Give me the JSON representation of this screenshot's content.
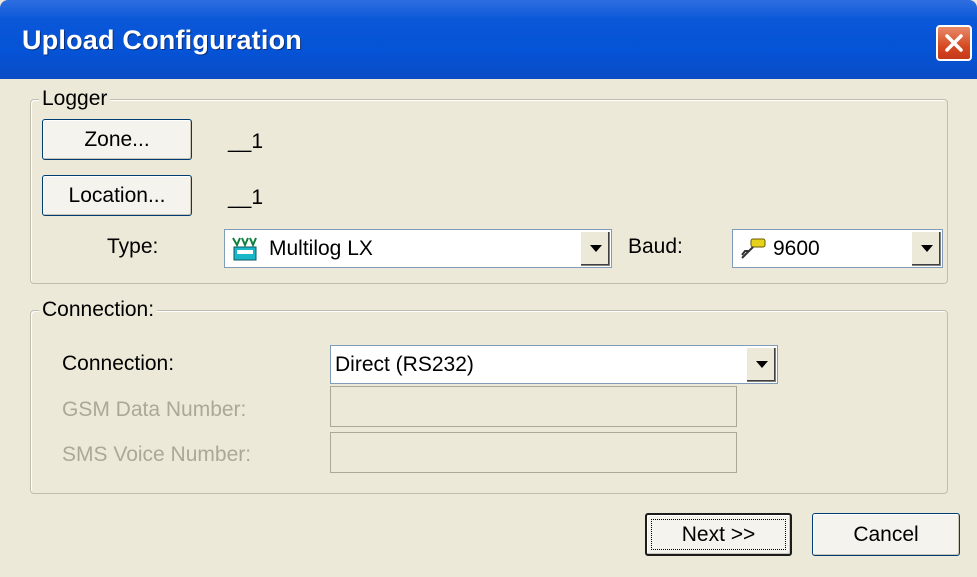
{
  "window": {
    "title": "Upload Configuration"
  },
  "logger": {
    "legend": "Logger",
    "zone_button": "Zone...",
    "zone_value": "__1",
    "location_button": "Location...",
    "location_value": "__1",
    "type_label": "Type:",
    "type_value": "Multilog LX",
    "type_icon": "multilog-device-icon",
    "baud_label": "Baud:",
    "baud_value": "9600",
    "baud_icon": "serial-cable-icon"
  },
  "connection": {
    "legend": "Connection:",
    "connection_label": "Connection:",
    "connection_value": "Direct (RS232)",
    "gsm_label": "GSM Data Number:",
    "gsm_value": "",
    "sms_label": "SMS Voice Number:",
    "sms_value": ""
  },
  "footer": {
    "next_button": "Next >>",
    "cancel_button": "Cancel"
  }
}
